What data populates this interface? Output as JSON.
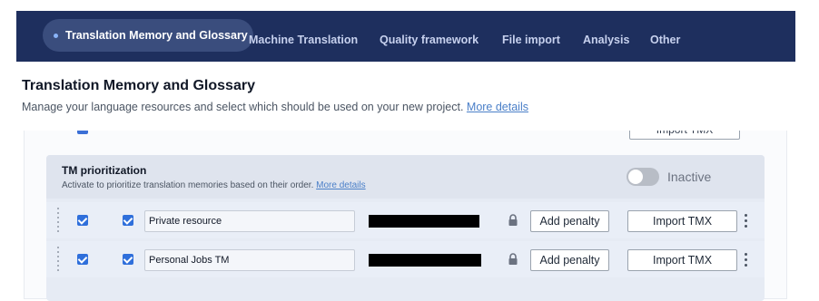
{
  "nav": {
    "tabs": [
      {
        "label": "Translation Memory and Glossary",
        "active": true
      },
      {
        "label": "Machine Translation",
        "active": false
      },
      {
        "label": "Quality framework",
        "active": false
      },
      {
        "label": "File import",
        "active": false
      },
      {
        "label": "Analysis",
        "active": false
      },
      {
        "label": "Other",
        "active": false
      }
    ]
  },
  "page": {
    "title": "Translation Memory and Glossary",
    "description": "Manage your language resources and select which should be used on your new project.",
    "more_details": "More details"
  },
  "cut_off_row": {
    "import_label": "Import TMX"
  },
  "tm_prioritization": {
    "title": "TM prioritization",
    "description": "Activate to prioritize translation memories based on their order.",
    "more_details": "More details",
    "toggle_label": "Inactive",
    "toggle_on": false
  },
  "tm_rows": [
    {
      "name": "Private resource",
      "checkbox_a": true,
      "checkbox_b": true,
      "add_penalty": "Add penalty",
      "import": "Import TMX",
      "lock_icon": "lock-icon",
      "menu_icon": "kebab-menu-icon"
    },
    {
      "name": "Personal Jobs TM",
      "checkbox_a": true,
      "checkbox_b": true,
      "add_penalty": "Add penalty",
      "import": "Import TMX",
      "lock_icon": "lock-icon",
      "menu_icon": "kebab-menu-icon"
    }
  ],
  "colors": {
    "nav_bg": "#1e2f5e",
    "nav_active": "#3a4d7d",
    "link": "#4a7fc8",
    "checkbox": "#2f6fdb"
  }
}
